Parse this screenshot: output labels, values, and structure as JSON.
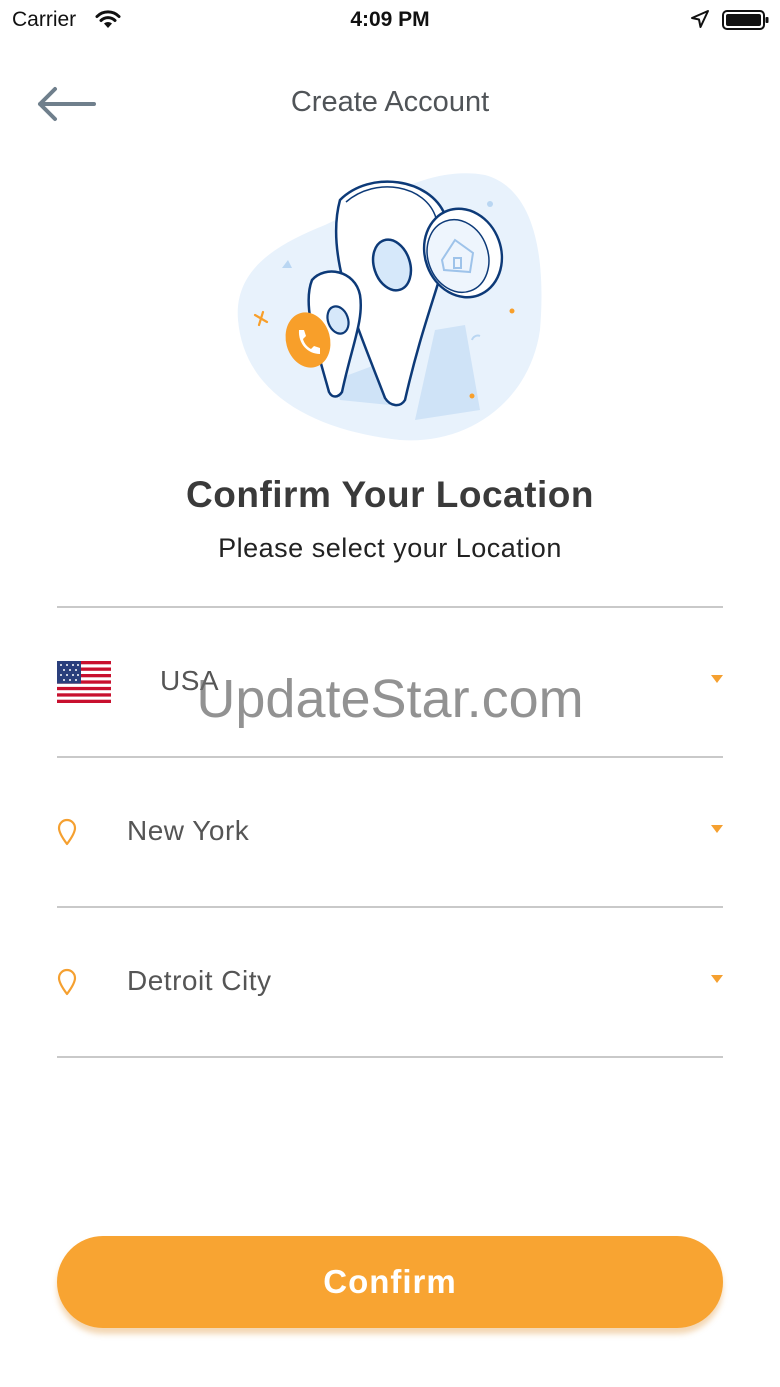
{
  "status_bar": {
    "carrier": "Carrier",
    "time": "4:09 PM",
    "icons": [
      "wifi-icon",
      "location-arrow-icon",
      "battery-icon"
    ]
  },
  "nav": {
    "title": "Create Account",
    "back_icon": "arrow-left-icon"
  },
  "illustration": {
    "icons": [
      "map-pin-icon",
      "phone-icon",
      "home-icon"
    ]
  },
  "heading": {
    "title": "Confirm Your Location",
    "subtitle": "Please select your Location"
  },
  "fields": [
    {
      "icon": "us-flag-icon",
      "value": "USA"
    },
    {
      "icon": "location-pin-icon",
      "value": "New York"
    },
    {
      "icon": "location-pin-icon",
      "value": "Detroit City"
    }
  ],
  "watermark": "UpdateStar.com",
  "confirm_label": "Confirm",
  "colors": {
    "accent": "#f8a432",
    "text": "#333333",
    "divider": "#c9c9c9",
    "illustration_blue": "#0d3a78",
    "illustration_bg": "#e6f1fb"
  }
}
